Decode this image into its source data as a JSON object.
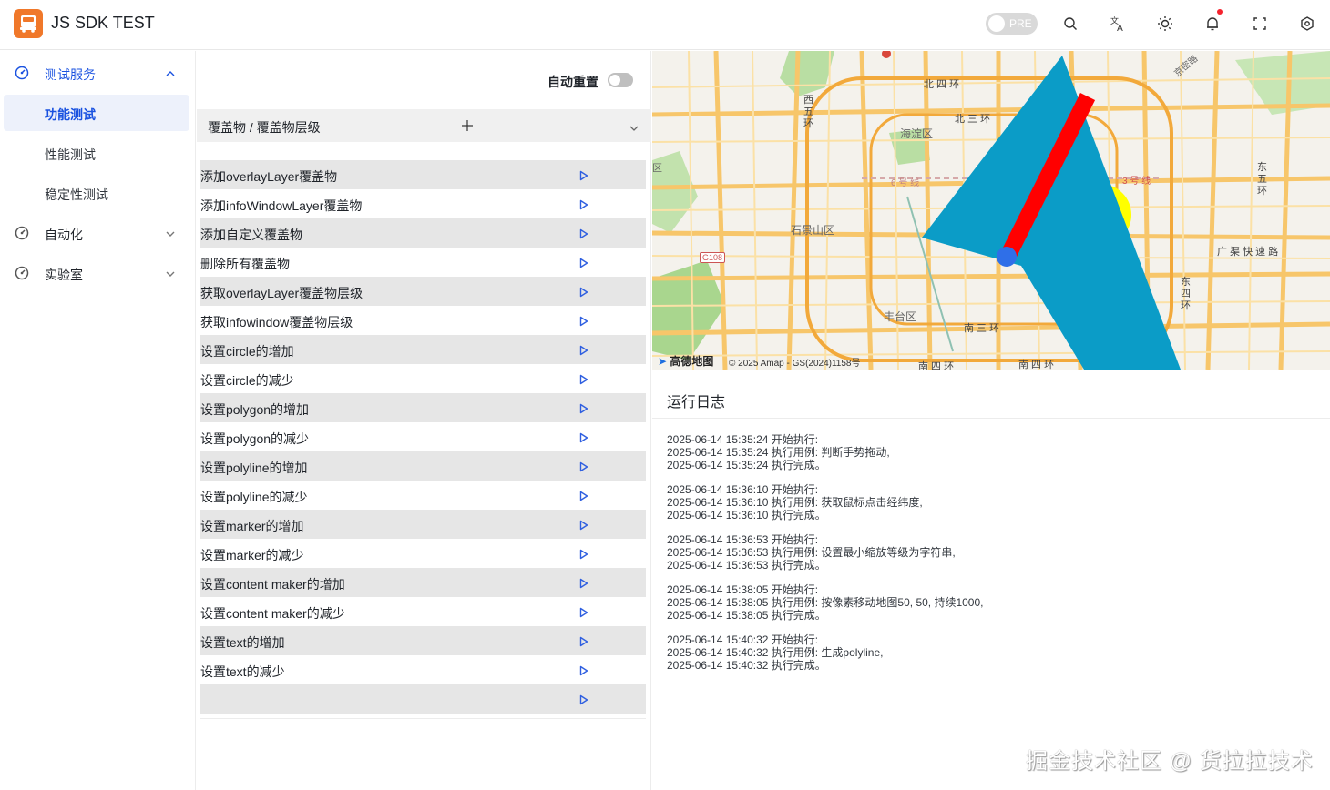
{
  "header": {
    "app_title": "JS SDK TEST",
    "env_toggle_label": "PRE",
    "icons": [
      "search-icon",
      "translate-icon",
      "theme-sun-icon",
      "bell-icon",
      "fullscreen-icon",
      "settings-icon"
    ],
    "accent_color": "#1a52e0",
    "logo_color": "#f0782a"
  },
  "sidebar": {
    "groups": [
      {
        "label": "测试服务",
        "icon": "dashboard-icon",
        "expanded": true,
        "items": [
          {
            "label": "功能测试",
            "active": true
          },
          {
            "label": "性能测试",
            "active": false
          },
          {
            "label": "稳定性测试",
            "active": false
          }
        ]
      },
      {
        "label": "自动化",
        "icon": "dashboard-icon",
        "expanded": false
      },
      {
        "label": "实验室",
        "icon": "dashboard-icon",
        "expanded": false
      }
    ]
  },
  "panel": {
    "auto_reset_label": "自动重置",
    "auto_reset_on": false,
    "category_select": "覆盖物 / 覆盖物层级",
    "cases": [
      "添加overlayLayer覆盖物",
      "添加infoWindowLayer覆盖物",
      "添加自定义覆盖物",
      "删除所有覆盖物",
      "获取overlayLayer覆盖物层级",
      "获取infowindow覆盖物层级",
      "设置circle的增加",
      "设置circle的减少",
      "设置polygon的增加",
      "设置polygon的减少",
      "设置polyline的增加",
      "设置polyline的减少",
      "设置marker的增加",
      "设置marker的减少",
      "设置content maker的增加",
      "设置content maker的减少",
      "设置text的增加",
      "设置text的减少",
      ""
    ]
  },
  "map": {
    "labels": {
      "north4": "北 四 环",
      "north3": "北 三 环",
      "haidian": "海淀区",
      "west5": "西五环",
      "line6": "6 号 线",
      "line3": "3 号 线",
      "shijingshan": "石景山区",
      "g108": "G108",
      "fengtai": "丰台区",
      "south3": "南 三 环",
      "south4a": "南 四 环",
      "south4b": "南 四 环",
      "east5": "东五环",
      "east4": "东四环",
      "guangqu": "广 渠 快 速 路",
      "xiqu": "区",
      "airport": "京密路"
    },
    "attribution_logo": "高德地图",
    "attribution_text": "© 2025 Amap - GS(2024)1158号",
    "overlay_colors": {
      "polygon": "#0b9cc7",
      "polyline": "#ff0000",
      "marker": "#2f6fe8",
      "circle": "#ffff00"
    }
  },
  "log": {
    "title": "运行日志",
    "entries": [
      [
        "2025-06-14 15:35:24 开始执行:",
        "2025-06-14 15:35:24 执行用例: 判断手势拖动,",
        "2025-06-14 15:35:24 执行完成。"
      ],
      [
        "2025-06-14 15:36:10 开始执行:",
        "2025-06-14 15:36:10 执行用例: 获取鼠标点击经纬度,",
        "2025-06-14 15:36:10 执行完成。"
      ],
      [
        "2025-06-14 15:36:53 开始执行:",
        "2025-06-14 15:36:53 执行用例: 设置最小缩放等级为字符串,",
        "2025-06-14 15:36:53 执行完成。"
      ],
      [
        "2025-06-14 15:38:05 开始执行:",
        "2025-06-14 15:38:05 执行用例: 按像素移动地图50, 50, 持续1000,",
        "2025-06-14 15:38:05 执行完成。"
      ],
      [
        "2025-06-14 15:40:32 开始执行:",
        "2025-06-14 15:40:32 执行用例: 生成polyline,",
        "2025-06-14 15:40:32 执行完成。"
      ]
    ]
  },
  "watermark": "掘金技术社区 @ 货拉拉技术"
}
